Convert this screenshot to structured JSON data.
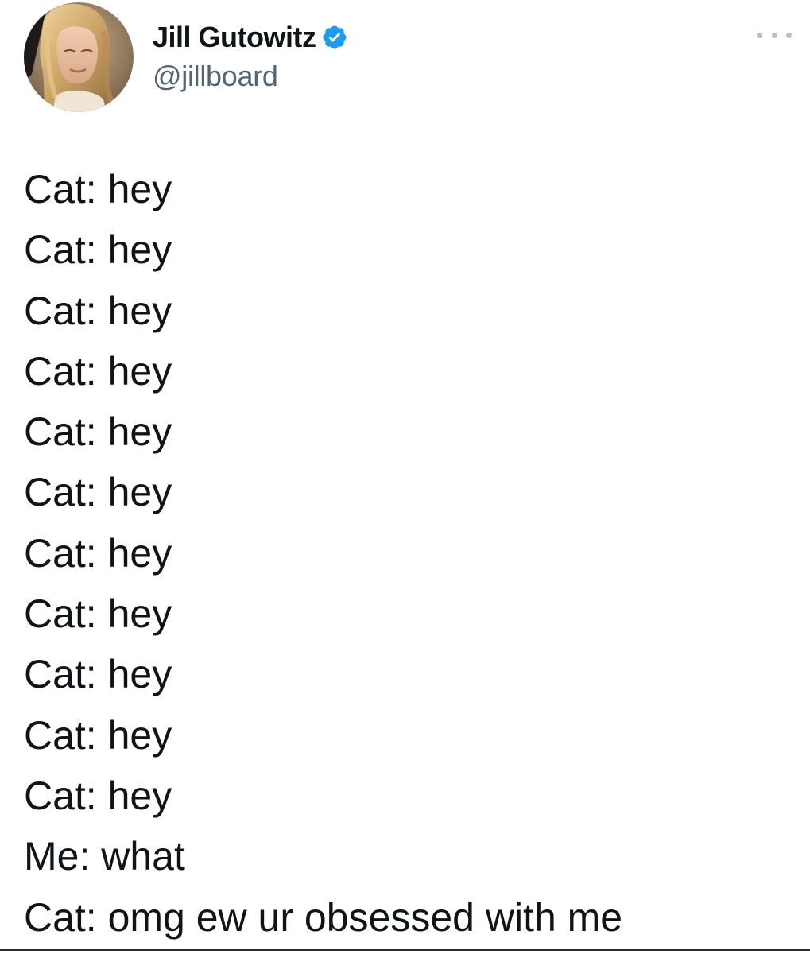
{
  "author": {
    "display_name": "Jill Gutowitz",
    "handle": "@jillboard",
    "verified": true,
    "verified_icon": "verified-badge-icon",
    "avatar_icon": "avatar-photo"
  },
  "menu": {
    "icon": "more-options-icon"
  },
  "tweet": {
    "lines": [
      "Cat: hey",
      "Cat: hey",
      "Cat: hey",
      "Cat: hey",
      "Cat: hey",
      "Cat: hey",
      "Cat: hey",
      "Cat: hey",
      "Cat: hey",
      "Cat: hey",
      "Cat: hey",
      "Me: what",
      "Cat: omg ew ur obsessed with me"
    ]
  },
  "colors": {
    "text_primary": "#0f1419",
    "text_secondary": "#536471",
    "verified_blue": "#1d9bf0"
  }
}
